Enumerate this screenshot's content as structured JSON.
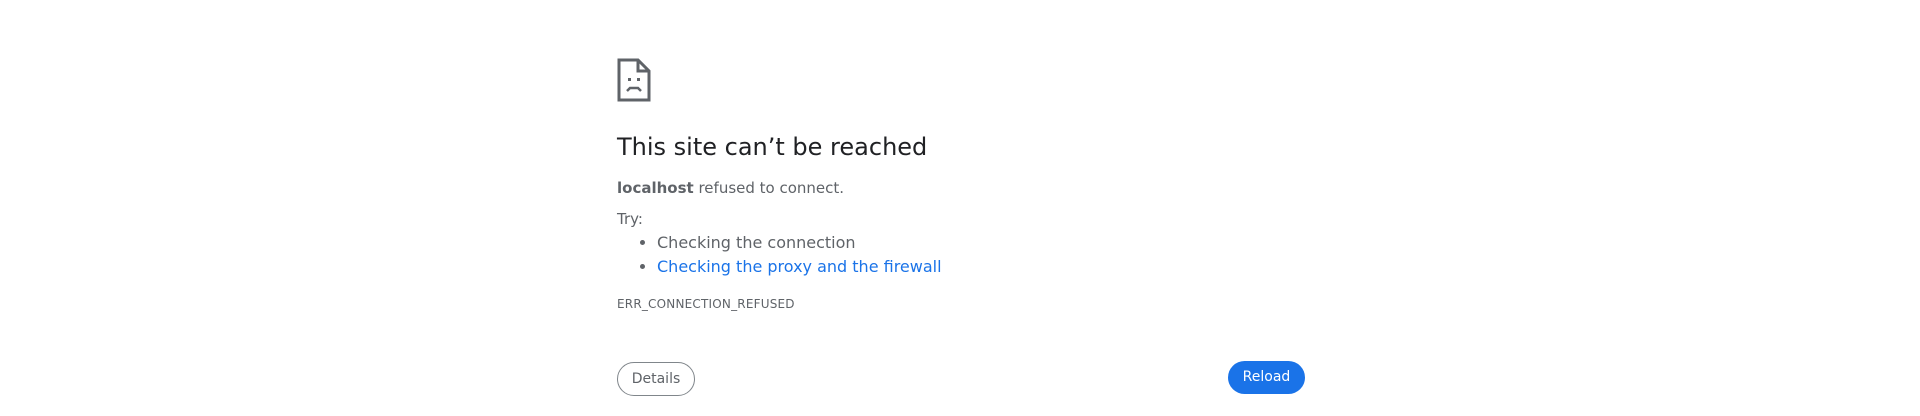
{
  "error": {
    "title": "This site can’t be reached",
    "host": "localhost",
    "message": "refused to connect.",
    "try_label": "Try:",
    "suggestions": [
      {
        "label": "Checking the connection",
        "is_link": false
      },
      {
        "label": "Checking the proxy and the firewall",
        "is_link": true
      }
    ],
    "code": "ERR_CONNECTION_REFUSED"
  },
  "buttons": {
    "details_label": "Details",
    "reload_label": "Reload"
  },
  "colors": {
    "accent": "#1a73e8",
    "title_text": "#202124",
    "body_text": "#5f6368",
    "button_border": "#80868b",
    "background": "#ffffff"
  },
  "icons": {
    "error_icon": "sad-page-icon"
  }
}
